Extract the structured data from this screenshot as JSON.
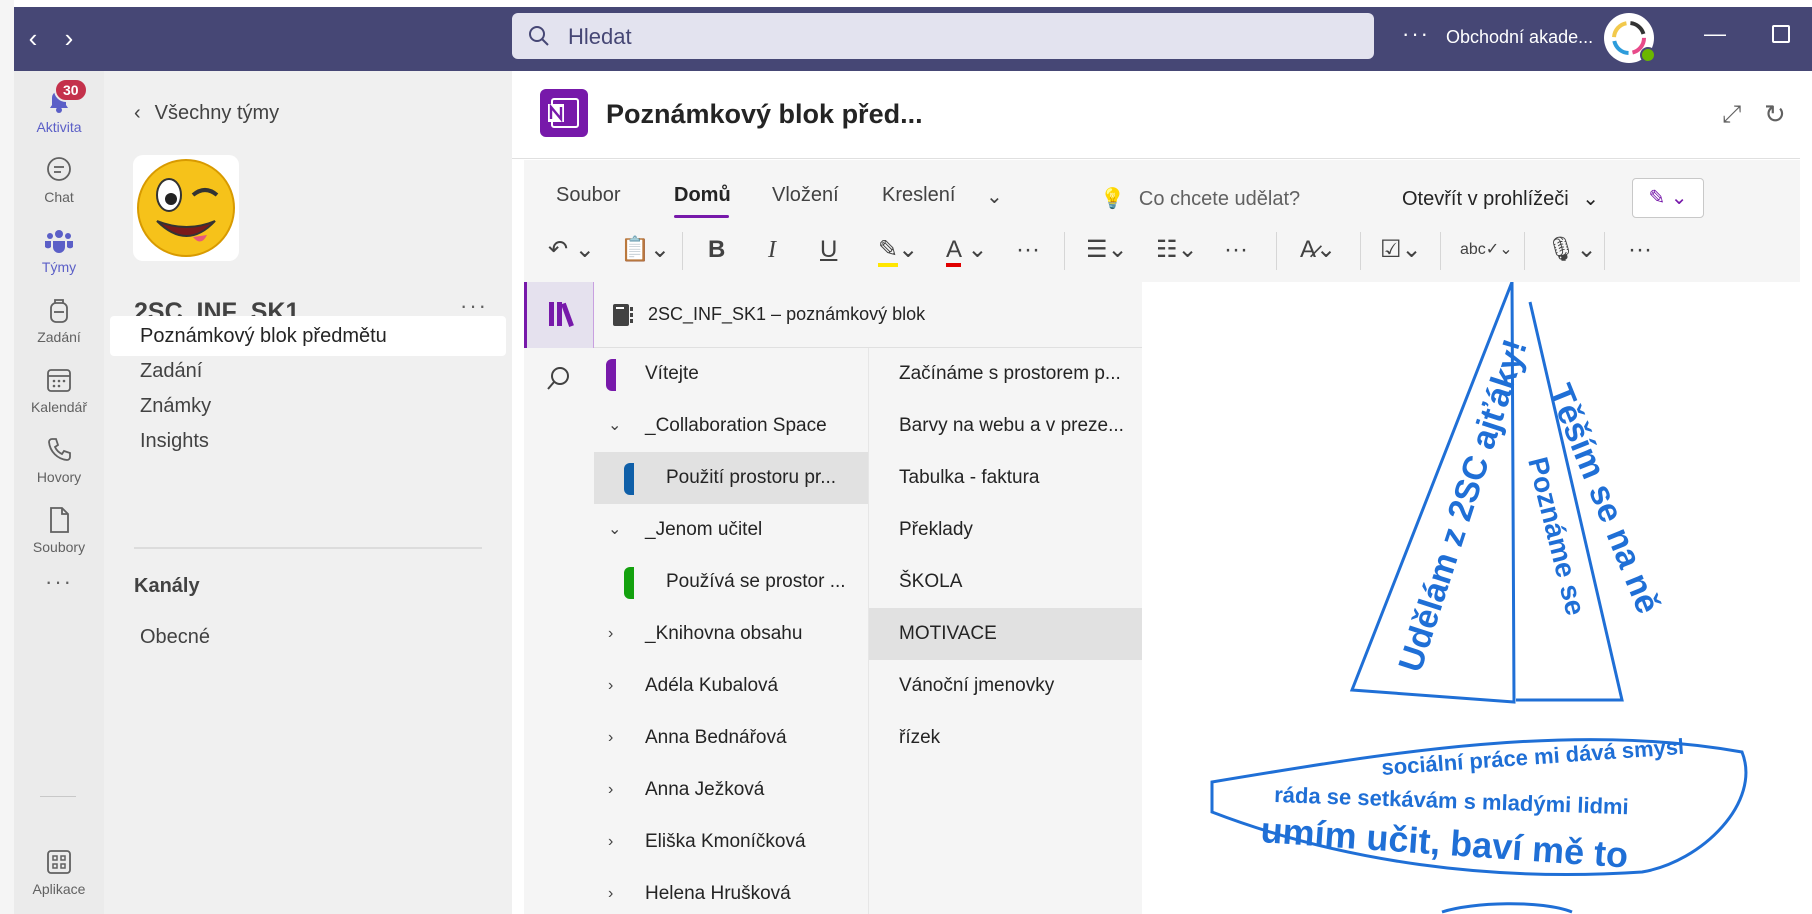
{
  "titlebar": {
    "search_placeholder": "Hledat",
    "more_label": "···",
    "org_name": "Obchodní akade..."
  },
  "appbar": {
    "items": [
      {
        "label": "Aktivita",
        "icon": "bell-icon",
        "badge": "30"
      },
      {
        "label": "Chat",
        "icon": "chat-icon"
      },
      {
        "label": "Týmy",
        "icon": "teams-icon"
      },
      {
        "label": "Zadání",
        "icon": "backpack-icon"
      },
      {
        "label": "Kalendář",
        "icon": "calendar-icon"
      },
      {
        "label": "Hovory",
        "icon": "phone-icon"
      },
      {
        "label": "Soubory",
        "icon": "file-icon"
      },
      {
        "label": "Aplikace",
        "icon": "apps-icon"
      }
    ],
    "more_label": "···"
  },
  "team_panel": {
    "back_label": "Všechny týmy",
    "team_name": "2SC_INF_SK1",
    "more_label": "···",
    "items": [
      {
        "label": "Poznámkový blok předmětu"
      },
      {
        "label": "Zadání"
      },
      {
        "label": "Známky"
      },
      {
        "label": "Insights"
      }
    ],
    "channels_heading": "Kanály",
    "channels": [
      {
        "label": "Obecné"
      }
    ]
  },
  "header": {
    "title": "Poznámkový blok před...",
    "logo_text": "N"
  },
  "ribbon": {
    "tabs": [
      {
        "label": "Soubor"
      },
      {
        "label": "Domů"
      },
      {
        "label": "Vložení"
      },
      {
        "label": "Kreslení"
      }
    ],
    "help_placeholder": "Co chcete udělat?",
    "open_in_viewer": "Otevřít v prohlížeči"
  },
  "notebook": {
    "title": "2SC_INF_SK1 – poznámkový blok",
    "sections": [
      {
        "label": "Vítejte",
        "tab_color": "#7719aa",
        "kind": "section"
      },
      {
        "label": "_Collaboration Space",
        "kind": "group",
        "expanded": true
      },
      {
        "label": "Použití prostoru pr...",
        "tab_color": "#0f5fa8",
        "kind": "subsection"
      },
      {
        "label": "_Jenom učitel",
        "kind": "group",
        "expanded": true
      },
      {
        "label": "Používá se prostor ...",
        "tab_color": "#13a10e",
        "kind": "subsection"
      },
      {
        "label": "_Knihovna obsahu",
        "kind": "group",
        "expanded": false
      },
      {
        "label": "Adéla Kubalová",
        "kind": "group",
        "expanded": false
      },
      {
        "label": "Anna Bednářová",
        "kind": "group",
        "expanded": false
      },
      {
        "label": "Anna Ježková",
        "kind": "group",
        "expanded": false
      },
      {
        "label": "Eliška Kmoníčková",
        "kind": "group",
        "expanded": false
      },
      {
        "label": "Helena Hrušková",
        "kind": "group",
        "expanded": false
      }
    ],
    "pages": [
      {
        "label": "Začínáme s prostorem p..."
      },
      {
        "label": "Barvy na webu a v preze..."
      },
      {
        "label": "Tabulka - faktura"
      },
      {
        "label": "Překlady"
      },
      {
        "label": "ŠKOLA"
      },
      {
        "label": "MOTIVACE"
      },
      {
        "label": "Vánoční jmenovky"
      },
      {
        "label": "řízek"
      }
    ]
  },
  "canvas": {
    "sail_left_text": "Udělám z 2SC ajťáky!",
    "sail_right_text_1": "Těším se na ně",
    "sail_right_text_2": "Poznáme se",
    "hull_text_1": "sociální práce mi dává smysl",
    "hull_text_2": "ráda se setkávám s mladými lidmi",
    "hull_text_3": "umím učit, baví mě to",
    "ink_color": "#1f6fd6"
  },
  "colors": {
    "titlebar": "#464775",
    "accent": "#5b5fc7",
    "onenote": "#7719aa",
    "badge": "#c4314b"
  }
}
